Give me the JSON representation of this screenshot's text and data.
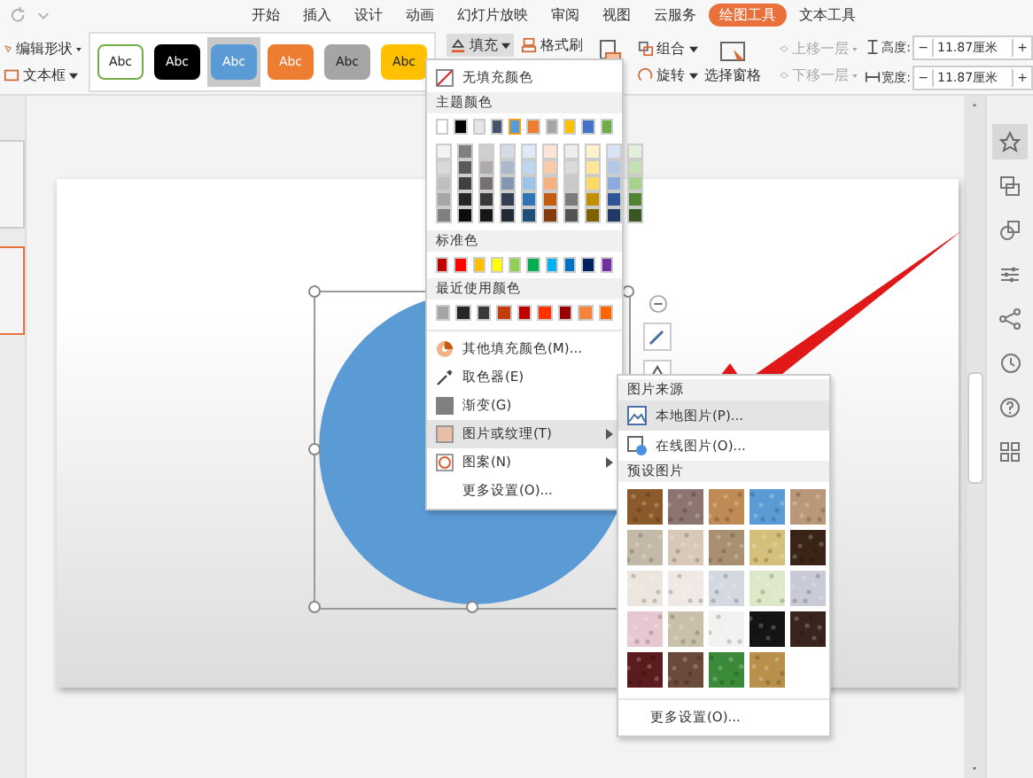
{
  "menu_tabs": [
    {
      "label": "开始",
      "selected": false
    },
    {
      "label": "插入",
      "selected": false
    },
    {
      "label": "设计",
      "selected": false
    },
    {
      "label": "动画",
      "selected": false
    },
    {
      "label": "幻灯片放映",
      "selected": false
    },
    {
      "label": "审阅",
      "selected": false
    },
    {
      "label": "视图",
      "selected": false
    },
    {
      "label": "云服务",
      "selected": false
    },
    {
      "label": "绘图工具",
      "selected": true
    },
    {
      "label": "文本工具",
      "selected": false
    }
  ],
  "ribbon": {
    "edit_shape": "编辑形状",
    "text_box": "文本框",
    "styles": [
      {
        "label": "Abc",
        "color": "#ffffff",
        "selected": false
      },
      {
        "label": "Abc",
        "color": "#000000",
        "selected": false
      },
      {
        "label": "Abc",
        "color": "#5b9bd5",
        "selected": true
      },
      {
        "label": "Abc",
        "color": "#ed7d31",
        "selected": false
      },
      {
        "label": "Abc",
        "color": "#a5a5a5",
        "selected": false
      },
      {
        "label": "Abc",
        "color": "#ffc000",
        "selected": false
      }
    ],
    "fill": "填充",
    "format_painter": "格式刷",
    "group": "组合",
    "rotate": "旋转",
    "selection_pane": "选择窗格",
    "bring_forward": {
      "label": "上移一层",
      "disabled": true
    },
    "send_backward": {
      "label": "下移一层",
      "disabled": true
    },
    "height_label": "高度:",
    "height_value": "11.87厘米",
    "width_label": "宽度:",
    "width_value": "11.87厘米",
    "minus": "−",
    "plus": "+"
  },
  "fill_menu": {
    "no_fill": "无填充颜色",
    "theme_header": "主题颜色",
    "theme_colors": [
      {
        "color": "#ffffff",
        "selected": false,
        "shades": [
          {
            "color": "#f2f2f2"
          },
          {
            "color": "#d9d9d9"
          },
          {
            "color": "#bfbfbf"
          },
          {
            "color": "#a6a6a6"
          },
          {
            "color": "#808080"
          }
        ]
      },
      {
        "color": "#000000",
        "selected": false,
        "shades": [
          {
            "color": "#808080"
          },
          {
            "color": "#595959"
          },
          {
            "color": "#404040"
          },
          {
            "color": "#262626"
          },
          {
            "color": "#0d0d0d"
          }
        ]
      },
      {
        "color": "#e7e6e6",
        "selected": false,
        "shades": [
          {
            "color": "#d0cece"
          },
          {
            "color": "#aeaaaa"
          },
          {
            "color": "#757171"
          },
          {
            "color": "#3b3838"
          },
          {
            "color": "#171616"
          }
        ]
      },
      {
        "color": "#44546a",
        "selected": false,
        "shades": [
          {
            "color": "#d6dce5"
          },
          {
            "color": "#adb9ca"
          },
          {
            "color": "#8497b0"
          },
          {
            "color": "#333f50"
          },
          {
            "color": "#222a35"
          }
        ]
      },
      {
        "color": "#5b9bd5",
        "selected": true,
        "shades": [
          {
            "color": "#deebf7"
          },
          {
            "color": "#bdd7ee"
          },
          {
            "color": "#9dc3e6"
          },
          {
            "color": "#2e75b6"
          },
          {
            "color": "#1f4e79"
          }
        ]
      },
      {
        "color": "#ed7d31",
        "selected": false,
        "shades": [
          {
            "color": "#fbe5d6"
          },
          {
            "color": "#f8cbad"
          },
          {
            "color": "#f4b183"
          },
          {
            "color": "#c55a11"
          },
          {
            "color": "#843c0c"
          }
        ]
      },
      {
        "color": "#a5a5a5",
        "selected": false,
        "shades": [
          {
            "color": "#ededed"
          },
          {
            "color": "#dbdbdb"
          },
          {
            "color": "#c9c9c9"
          },
          {
            "color": "#7b7b7b"
          },
          {
            "color": "#525252"
          }
        ]
      },
      {
        "color": "#ffc000",
        "selected": false,
        "shades": [
          {
            "color": "#fff2cc"
          },
          {
            "color": "#ffe699"
          },
          {
            "color": "#ffd966"
          },
          {
            "color": "#bf9000"
          },
          {
            "color": "#7f6000"
          }
        ]
      },
      {
        "color": "#4472c4",
        "selected": false,
        "shades": [
          {
            "color": "#dae3f3"
          },
          {
            "color": "#b4c7e7"
          },
          {
            "color": "#8faadc"
          },
          {
            "color": "#2f5597"
          },
          {
            "color": "#203864"
          }
        ]
      },
      {
        "color": "#70ad47",
        "selected": false,
        "shades": [
          {
            "color": "#e2f0d9"
          },
          {
            "color": "#c5e0b4"
          },
          {
            "color": "#a9d18e"
          },
          {
            "color": "#548235"
          },
          {
            "color": "#385723"
          }
        ]
      }
    ],
    "standard_header": "标准色",
    "standard_colors": [
      {
        "color": "#c00000"
      },
      {
        "color": "#ff0000"
      },
      {
        "color": "#ffc000"
      },
      {
        "color": "#ffff00"
      },
      {
        "color": "#92d050"
      },
      {
        "color": "#00b050"
      },
      {
        "color": "#00b0f0"
      },
      {
        "color": "#0070c0"
      },
      {
        "color": "#002060"
      },
      {
        "color": "#7030a0"
      }
    ],
    "recent_header": "最近使用颜色",
    "recent_colors": [
      {
        "color": "#a5a5a5"
      },
      {
        "color": "#262626"
      },
      {
        "color": "#3a3a3a"
      },
      {
        "color": "#c43c0c"
      },
      {
        "color": "#c00000"
      },
      {
        "color": "#ff3300"
      },
      {
        "color": "#990000"
      },
      {
        "color": "#f4833d"
      },
      {
        "color": "#ff6600"
      }
    ],
    "items": [
      {
        "kind": "palette",
        "label": "其他填充颜色(M)...",
        "submenu": false,
        "selected": false
      },
      {
        "kind": "eyedropper",
        "label": "取色器(E)",
        "submenu": false,
        "selected": false
      },
      {
        "kind": "gradient",
        "label": "渐变(G)",
        "submenu": false,
        "selected": false
      },
      {
        "kind": "texture",
        "label": "图片或纹理(T)",
        "submenu": true,
        "selected": true
      },
      {
        "kind": "pattern",
        "label": "图案(N)",
        "submenu": true,
        "selected": false
      },
      {
        "kind": "none",
        "label": "更多设置(O)...",
        "submenu": false,
        "selected": false
      }
    ]
  },
  "picture_menu": {
    "source_header": "图片来源",
    "items": [
      {
        "kind": "local",
        "label": "本地图片(P)...",
        "selected": true
      },
      {
        "kind": "online",
        "label": "在线图片(O)...",
        "selected": false
      }
    ],
    "preset_header": "预设图片",
    "textures": [
      {
        "color": "#8a5a2b"
      },
      {
        "color": "#8c7470"
      },
      {
        "color": "#c08a55"
      },
      {
        "color": "#5b9bd5"
      },
      {
        "color": "#b89878"
      },
      {
        "color": "#c4b9a8"
      },
      {
        "color": "#d8c8b8"
      },
      {
        "color": "#a89070"
      },
      {
        "color": "#d4c07a"
      },
      {
        "color": "#3a2418"
      },
      {
        "color": "#ece6de"
      },
      {
        "color": "#f0e8e4"
      },
      {
        "color": "#d4d8e0"
      },
      {
        "color": "#dce8c8"
      },
      {
        "color": "#c8cad6"
      },
      {
        "color": "#e8c8d0"
      },
      {
        "color": "#c8c0a8"
      },
      {
        "color": "#f4f2f0"
      },
      {
        "color": "#141414"
      },
      {
        "color": "#3a2420"
      },
      {
        "color": "#5a1c1c"
      },
      {
        "color": "#6a4a3a"
      },
      {
        "color": "#3a8a3a"
      },
      {
        "color": "#b8904a"
      }
    ],
    "more": "更多设置(O)..."
  }
}
